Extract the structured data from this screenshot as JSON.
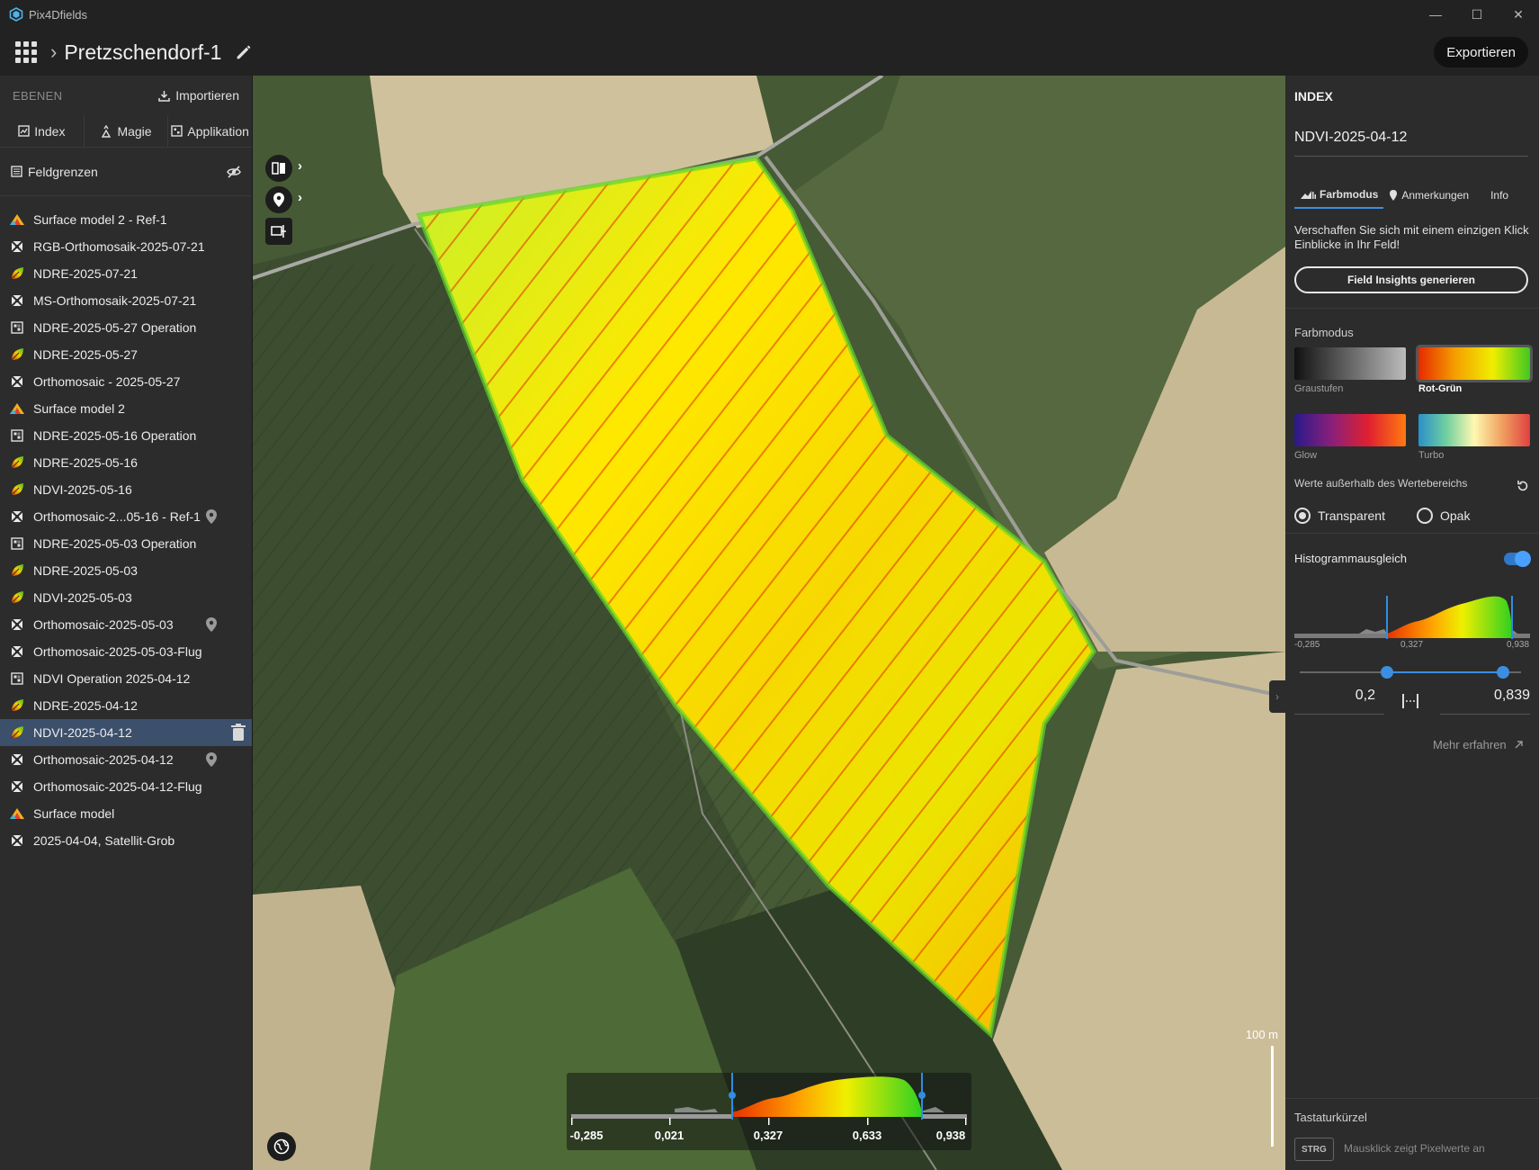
{
  "window": {
    "app_title": "Pix4Dfields",
    "minimize": "—",
    "maximize": "☐",
    "close": "✕"
  },
  "header": {
    "project_title": "Pretzschendorf-1",
    "export_label": "Exportieren"
  },
  "sidebar": {
    "section_label": "EBENEN",
    "import_label": "Importieren",
    "tabs": [
      {
        "label": "Index",
        "icon": "index-icon"
      },
      {
        "label": "Magie",
        "icon": "magic-icon"
      },
      {
        "label": "Applikation",
        "icon": "application-icon"
      }
    ],
    "field_bounds_label": "Feldgrenzen",
    "layers": [
      {
        "label": "Surface model 2 - Ref-1",
        "icon": "surface-model-icon",
        "pin": false
      },
      {
        "label": "RGB-Orthomosaik-2025-07-21",
        "icon": "orthomosaic-icon",
        "pin": false
      },
      {
        "label": "NDRE-2025-07-21",
        "icon": "index-leaf-icon",
        "pin": false
      },
      {
        "label": "MS-Orthomosaik-2025-07-21",
        "icon": "orthomosaic-icon",
        "pin": false
      },
      {
        "label": "NDRE-2025-05-27 Operation",
        "icon": "operation-icon",
        "pin": false
      },
      {
        "label": "NDRE-2025-05-27",
        "icon": "index-leaf-icon",
        "pin": false
      },
      {
        "label": "Orthomosaic - 2025-05-27",
        "icon": "orthomosaic-icon",
        "pin": false
      },
      {
        "label": "Surface model 2",
        "icon": "surface-model-icon",
        "pin": false
      },
      {
        "label": "NDRE-2025-05-16 Operation",
        "icon": "operation-icon",
        "pin": false
      },
      {
        "label": "NDRE-2025-05-16",
        "icon": "index-leaf-icon",
        "pin": false
      },
      {
        "label": "NDVI-2025-05-16",
        "icon": "index-leaf-icon",
        "pin": false
      },
      {
        "label": "Orthomosaic-2...05-16 - Ref-1",
        "icon": "orthomosaic-icon",
        "pin": true
      },
      {
        "label": "NDRE-2025-05-03 Operation",
        "icon": "operation-icon",
        "pin": false
      },
      {
        "label": "NDRE-2025-05-03",
        "icon": "index-leaf-icon",
        "pin": false
      },
      {
        "label": "NDVI-2025-05-03",
        "icon": "index-leaf-icon",
        "pin": false
      },
      {
        "label": "Orthomosaic-2025-05-03",
        "icon": "orthomosaic-icon",
        "pin": true
      },
      {
        "label": "Orthomosaic-2025-05-03-Flug",
        "icon": "orthomosaic-icon",
        "pin": false
      },
      {
        "label": "NDVI Operation 2025-04-12",
        "icon": "operation-icon",
        "pin": false
      },
      {
        "label": "NDRE-2025-04-12",
        "icon": "index-leaf-icon",
        "pin": false
      },
      {
        "label": "NDVI-2025-04-12",
        "icon": "index-leaf-icon",
        "pin": false,
        "selected": true
      },
      {
        "label": "Orthomosaic-2025-04-12",
        "icon": "orthomosaic-icon",
        "pin": true
      },
      {
        "label": "Orthomosaic-2025-04-12-Flug",
        "icon": "orthomosaic-icon",
        "pin": false
      },
      {
        "label": "Surface model",
        "icon": "surface-model-icon",
        "pin": false
      },
      {
        "label": "2025-04-04, Satellit-Grob",
        "icon": "orthomosaic-icon",
        "pin": false
      }
    ]
  },
  "map": {
    "scale_label": "100 m",
    "legend": {
      "ticks": [
        "-0,285",
        "0,021",
        "0,327",
        "0,633",
        "0,938"
      ]
    }
  },
  "panel": {
    "title": "INDEX",
    "layer_name": "NDVI-2025-04-12",
    "tabs": [
      {
        "label": "Farbmodus",
        "icon": "color-mode-icon",
        "active": true
      },
      {
        "label": "Anmerkungen",
        "icon": "pin-icon",
        "active": false
      },
      {
        "label": "Info",
        "icon": "",
        "active": false
      }
    ],
    "description": "Verschaffen Sie sich mit einem einzigen Klick Einblicke in Ihr Feld!",
    "insights_button": "Field Insights generieren",
    "color_mode_label": "Farbmodus",
    "color_modes": [
      {
        "label": "Graustufen",
        "selected": false
      },
      {
        "label": "Rot-Grün",
        "selected": true
      },
      {
        "label": "Glow",
        "selected": false
      },
      {
        "label": "Turbo",
        "selected": false
      }
    ],
    "out_of_range_label": "Werte außerhalb des Wertebereichs",
    "radio_transparent": "Transparent",
    "radio_opaque": "Opak",
    "radio_selected": "transparent",
    "histogram_label": "Histogrammausgleich",
    "histogram_enabled": true,
    "histogram_ticks": [
      "-0,285",
      "0,327",
      "0,938"
    ],
    "range_min": "0,2",
    "range_max": "0,839",
    "range_min_fraction": 0.395,
    "range_max_fraction": 0.92,
    "more_link": "Mehr erfahren",
    "shortcuts_title": "Tastaturkürzel",
    "shortcut_key": "STRG",
    "shortcut_desc": "Mausklick zeigt Pixelwerte an"
  },
  "colors": {
    "accent": "#3b8ee0",
    "selected_layer": "#3c4f6b",
    "panel_bg": "#2c2c2c"
  }
}
